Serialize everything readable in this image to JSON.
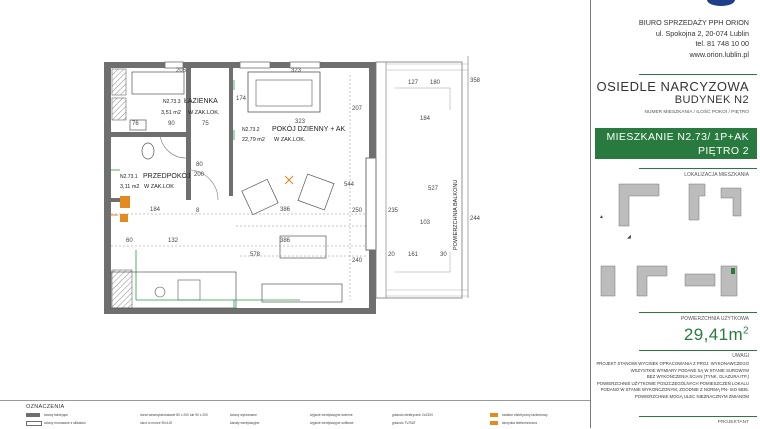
{
  "sales_office": {
    "name": "BIURO SPRZEDAŻY PPH ORION",
    "address": "ul. Spokojna 2, 20-074 Lublin",
    "phone": "tel. 81 748 10 00",
    "website": "www.orion.lublin.pl"
  },
  "estate": {
    "name": "OSIEDLE NARCYZOWA",
    "building": "BUDYNEK N2"
  },
  "apartment": {
    "label": "NUMER MIESZKANIA / ILOŚĆ POKOI / PIĘTRO",
    "title": "MIESZKANIE N2.73/ 1P+AK",
    "floor": "PIĘTRO 2"
  },
  "location": {
    "label": "LOKALIZACJA MIESZKANIA"
  },
  "usable_area": {
    "label": "POWIERZCHNIA UŻYTKOWA",
    "value": "29,41m",
    "unit_sup": "2"
  },
  "notes": {
    "title": "UWAGI",
    "lines": [
      "PROJEKT STANOWI WYCINEK OPRACOWANIA Z PROJ. WYKONAWCZEGO",
      "WSZYSTKIE WYMIARY PODANE SĄ W STANIE SUROWYM",
      "BEZ WYKOŃCZENIA ŚCIAN (TYNK, GLAZURA ITP.)",
      "POWIERZCHNIE UŻYTKOWE POSZCZEGÓLNYCH POMIESZCZEŃ LOKALU",
      "PODANO W STANIE WYKOŃCZONYM, ZGODNIE Z NORMĄ PN- ISO 9836.",
      "POWIERZCHNIE MOGĄ ULEC NIEZNACZNYM ZMIANOM"
    ]
  },
  "projektant": "PROJEKTANT",
  "rooms": {
    "bathroom": {
      "code": "N2.73.3",
      "name": "ŁAZIENKA",
      "area": "3,51 m2",
      "floor": "W ZAK.LOK."
    },
    "living": {
      "code": "N2.73.2",
      "name": "POKÓJ DZIENNY + AK",
      "area": "22,79 m2",
      "floor": "W ZAK.LOK."
    },
    "hall": {
      "code": "N2.73.1",
      "name": "PRZEDPOKÓJ",
      "area": "3,11 m2",
      "floor": "W ZAK.LOK"
    },
    "balcony": {
      "name": "POWIERZCHNIA BALKONU"
    }
  },
  "dimensions": {
    "top_206": "206",
    "top_323": "323",
    "top_323_b": "323",
    "b_90": "90",
    "b_75": "75",
    "b_76": "76",
    "r_174": "174",
    "r_207": "207",
    "r_544": "544",
    "d_80": "80",
    "d_200": "200",
    "d_386": "386",
    "d_386_b": "386",
    "d_184": "184",
    "d_60": "60",
    "d_132": "132",
    "d_578": "578",
    "d_250": "250",
    "d_235": "235",
    "d_240": "240",
    "d_8": "8",
    "bal_180": "180",
    "bal_127": "127",
    "bal_184": "184",
    "bal_358": "358",
    "bal_527": "527",
    "bal_103": "103",
    "bal_244": "244",
    "bal_161": "161",
    "bal_20": "20",
    "bal_30": "30"
  },
  "legend": {
    "title": "OZNACZENIA",
    "items": [
      "ściany istniejące",
      "ściany murowane z silikatów",
      "drzwi wewnątrzlokalowe 80 x 200 lub 90 x 200",
      "okno w murze 90x120",
      "ściany wyrównane",
      "kanały wentylacyjne",
      "wyjście wentylacyjne ścienne",
      "wyjście wentylacyjne sufitowe",
      "gniazdo elektryczne 2x230V",
      "gniazdo TV/SAT",
      "radiator elektryczny łazienkowy",
      "skrzynka teletechniczna"
    ]
  },
  "colors": {
    "brand_green": "#287a3e",
    "wall": "#6f6f6f",
    "dim_line": "#777777"
  }
}
